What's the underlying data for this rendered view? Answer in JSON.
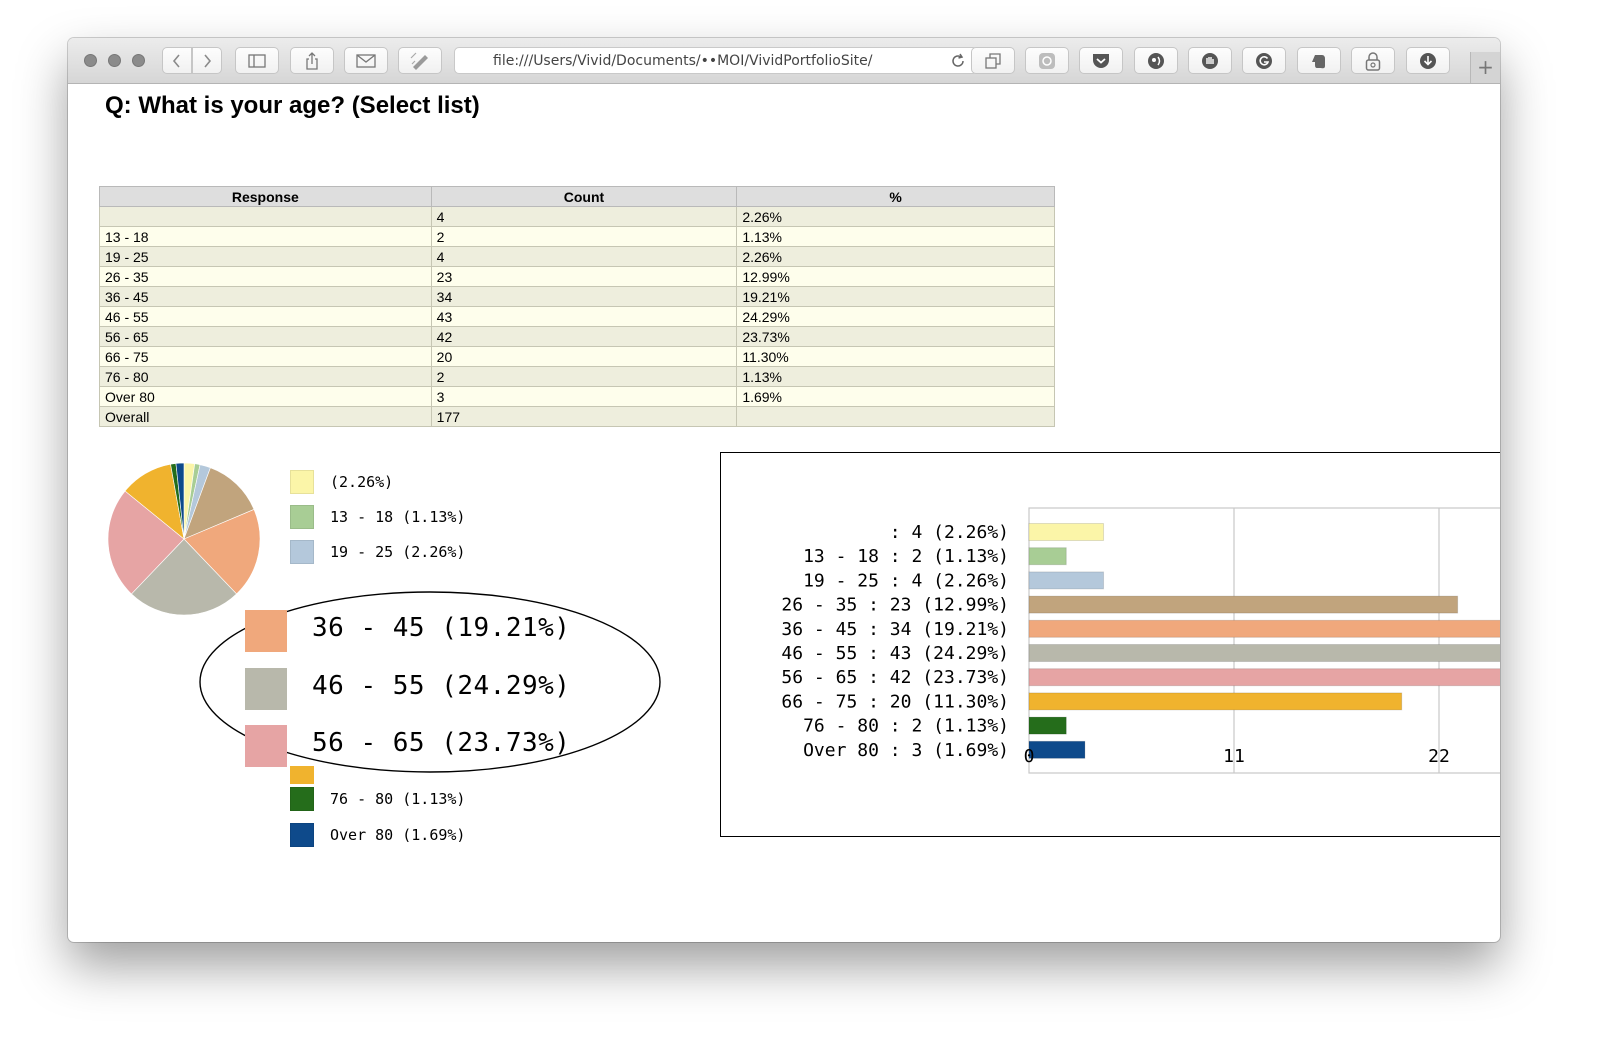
{
  "browser": {
    "url": "file:///Users/Vivid/Documents/••MOI/VividPortfolioSite/NSW%"
  },
  "page": {
    "title": "Q: What is your age? (Select list)"
  },
  "table": {
    "headers": [
      "Response",
      "Count",
      "%"
    ],
    "rows": [
      {
        "response": "",
        "count": "4",
        "percent": "2.26%"
      },
      {
        "response": "13 - 18",
        "count": "2",
        "percent": "1.13%"
      },
      {
        "response": "19 - 25",
        "count": "4",
        "percent": "2.26%"
      },
      {
        "response": "26 - 35",
        "count": "23",
        "percent": "12.99%"
      },
      {
        "response": "36 - 45",
        "count": "34",
        "percent": "19.21%"
      },
      {
        "response": "46 - 55",
        "count": "43",
        "percent": "24.29%"
      },
      {
        "response": "56 - 65",
        "count": "42",
        "percent": "23.73%"
      },
      {
        "response": "66 - 75",
        "count": "20",
        "percent": "11.30%"
      },
      {
        "response": "76 - 80",
        "count": "2",
        "percent": "1.13%"
      },
      {
        "response": "Over 80",
        "count": "3",
        "percent": "1.69%"
      },
      {
        "response": "Overall",
        "count": "177",
        "percent": ""
      }
    ]
  },
  "pie_legend": [
    "(2.26%)",
    "13 - 18 (1.13%)",
    "19 - 25 (2.26%)",
    "76 - 80 (1.13%)",
    "Over 80 (1.69%)"
  ],
  "zoom_legend": [
    "36 - 45 (19.21%)",
    "46 - 55 (24.29%)",
    "56 - 65 (23.73%)"
  ],
  "chart_data": [
    {
      "type": "pie",
      "categories": [
        "",
        "13 - 18",
        "19 - 25",
        "26 - 35",
        "36 - 45",
        "46 - 55",
        "56 - 65",
        "66 - 75",
        "76 - 80",
        "Over 80"
      ],
      "values": [
        4,
        2,
        4,
        23,
        34,
        43,
        42,
        20,
        2,
        3
      ],
      "percent_labels": [
        "2.26%",
        "1.13%",
        "2.26%",
        "12.99%",
        "19.21%",
        "24.29%",
        "23.73%",
        "11.30%",
        "1.13%",
        "1.69%"
      ],
      "colors": [
        "#fbf5a8",
        "#a8cd95",
        "#b4c8db",
        "#c1a47d",
        "#f0a87c",
        "#b8b8ab",
        "#e6a4a4",
        "#f0b32e",
        "#256d1b",
        "#0e4a8b"
      ],
      "legend_placement": "right"
    },
    {
      "type": "bar",
      "orientation": "horizontal",
      "categories": [
        "",
        "13 - 18",
        "19 - 25",
        "26 - 35",
        "36 - 45",
        "46 - 55",
        "56 - 65",
        "66 - 75",
        "76 - 80",
        "Over 80"
      ],
      "labels": [
        ": 4 (2.26%)",
        "13 - 18 : 2 (1.13%)",
        "19 - 25 : 4 (2.26%)",
        "26 - 35 : 23 (12.99%)",
        "36 - 45 : 34 (19.21%)",
        "46 - 55 : 43 (24.29%)",
        "56 - 65 : 42 (23.73%)",
        "66 - 75 : 20 (11.30%)",
        "76 - 80 : 2 (1.13%)",
        "Over 80 : 3 (1.69%)"
      ],
      "values": [
        4,
        2,
        4,
        23,
        34,
        43,
        42,
        20,
        2,
        3
      ],
      "colors": [
        "#fbf5a8",
        "#a8cd95",
        "#b4c8db",
        "#c1a47d",
        "#f0a87c",
        "#b8b8ab",
        "#e6a4a4",
        "#f0b32e",
        "#256d1b",
        "#0e4a8b"
      ],
      "x_ticks": [
        "0",
        "11",
        "22"
      ],
      "x_tick_values": [
        0,
        11,
        22
      ],
      "xlim": [
        0,
        22
      ],
      "grid": true
    }
  ]
}
